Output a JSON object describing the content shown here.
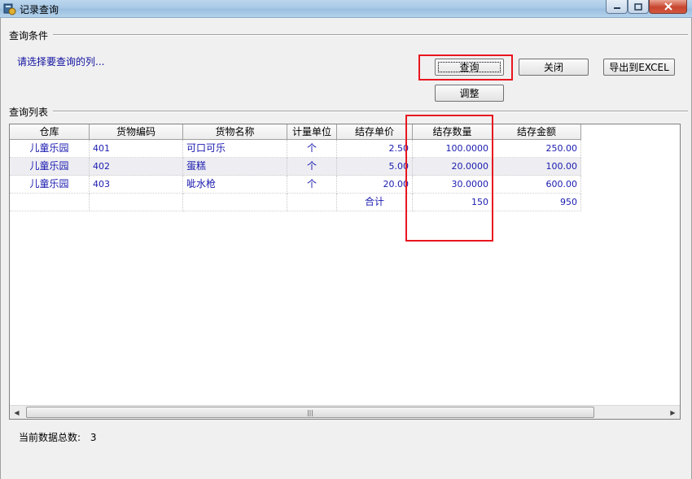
{
  "window": {
    "title": "记录查询",
    "icon": "app-icon"
  },
  "conditions": {
    "group_label": "查询条件",
    "hint": "请选择要查询的列..."
  },
  "buttons": {
    "query": "查询",
    "close": "关闭",
    "export": "导出到EXCEL",
    "adjust": "调整"
  },
  "list": {
    "group_label": "查询列表",
    "columns": [
      "仓库",
      "货物编码",
      "货物名称",
      "计量单位",
      "结存单价",
      "结存数量",
      "结存金额"
    ],
    "rows": [
      [
        "儿童乐园",
        "401",
        "可口可乐",
        "个",
        "2.50",
        "100.0000",
        "250.00"
      ],
      [
        "儿童乐园",
        "402",
        "蛋糕",
        "个",
        "5.00",
        "20.0000",
        "100.00"
      ],
      [
        "儿童乐园",
        "403",
        "呲水枪",
        "个",
        "20.00",
        "30.0000",
        "600.00"
      ]
    ],
    "total_row": [
      "",
      "",
      "",
      "",
      "合计",
      "150",
      "950"
    ],
    "scroll_grip": "|||"
  },
  "status": {
    "label": "当前数据总数:",
    "count": "3"
  },
  "colors": {
    "highlight": "#e8161f",
    "cell_text": "#1a1ab0"
  }
}
